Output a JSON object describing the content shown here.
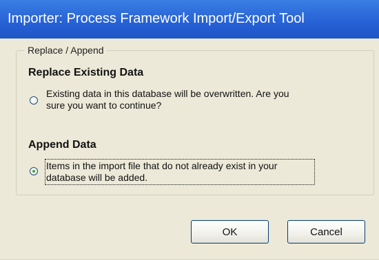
{
  "window": {
    "title": "Importer: Process Framework Import/Export Tool"
  },
  "group": {
    "label": "Replace / Append"
  },
  "options": [
    {
      "heading": "Replace Existing Data",
      "description_line_1": "Existing data in this database will be overwritten.  Are you",
      "description_line_2": "sure you want to continue?",
      "selected": false
    },
    {
      "heading": "Append Data",
      "description_line_1": "Items in the import file that do not already exist in your",
      "description_line_2": "database will be added.",
      "selected": true
    }
  ],
  "buttons": {
    "ok": "OK",
    "cancel": "Cancel"
  },
  "colors": {
    "title_bar": "#255FD4",
    "dialog_background": "#ECE9D8",
    "radio_selected": "#2C8F2F"
  }
}
